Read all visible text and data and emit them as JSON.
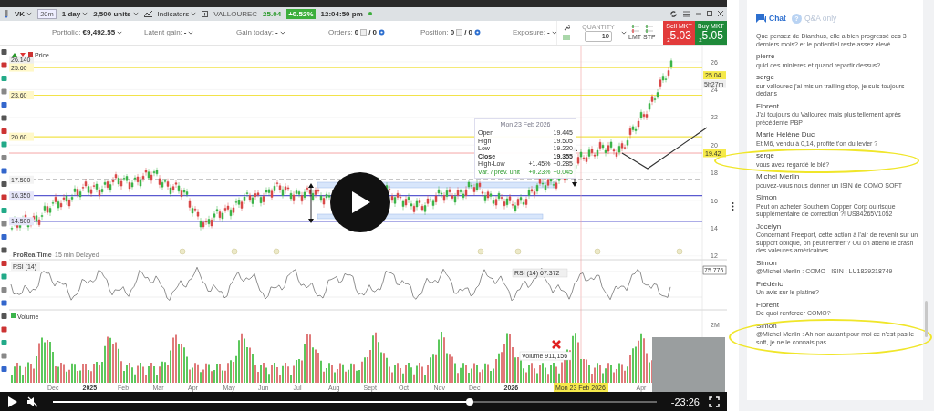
{
  "toolbar": {
    "symbol": "VK",
    "interval": "20m",
    "period": "1 day",
    "units": "2,500 units",
    "indicators": "Indicators",
    "instrument": "VALLOUREC",
    "last_price": "25.04",
    "change": "+0.52%",
    "time": "12:04:50 pm"
  },
  "account": [
    {
      "kind": "value",
      "label": "Portfolio:",
      "value": "€9,492.55"
    },
    {
      "kind": "value",
      "label": "Latent gain:",
      "value": "-"
    },
    {
      "kind": "value",
      "label": "Gain today:",
      "value": "-"
    },
    {
      "kind": "counter",
      "label": "Orders:",
      "value": "0",
      "total": "/ 0"
    },
    {
      "kind": "counter",
      "label": "Position:",
      "value": "0",
      "total": "/ 0"
    },
    {
      "kind": "value",
      "label": "Exposure:",
      "value": "-"
    }
  ],
  "order_ticket": {
    "quantity_label": "QUANTITY",
    "quantity": "10",
    "limit_label": "LMT",
    "stop_label": "STP",
    "sell": {
      "label": "Sell MKT",
      "price": "$_{2}$5.03"
    },
    "buy": {
      "label": "Buy MKT",
      "price": "$_{2}$5.05"
    }
  },
  "price_panel": {
    "legend": "Price",
    "source": "ProRealTime",
    "delay": "15 min Delayed",
    "axis_ticks": [
      "26",
      "24",
      "22",
      "20",
      "18",
      "16",
      "14",
      "12"
    ],
    "last_badge": "25.04",
    "countdown": "5h27m",
    "alert_badge": "19.42",
    "levels": [
      {
        "label": "26.140",
        "kind": "high"
      },
      {
        "label": "25.60",
        "kind": "resistance"
      },
      {
        "label": "23.60",
        "kind": "resistance"
      },
      {
        "label": "20.60",
        "kind": "resistance"
      },
      {
        "label": "17.500",
        "kind": "dashed"
      },
      {
        "label": "16.350",
        "kind": "support"
      },
      {
        "label": "14.500",
        "kind": "support"
      }
    ],
    "tooltip": {
      "date": "Mon 23 Feb 2026",
      "rows": [
        {
          "kind": "plain",
          "label": "Open",
          "value": "19.445"
        },
        {
          "kind": "plain",
          "label": "High",
          "value": "19.505"
        },
        {
          "kind": "plain",
          "label": "Low",
          "value": "19.220"
        },
        {
          "kind": "bold",
          "label": "Close",
          "value": "19.355"
        },
        {
          "kind": "plain",
          "label": "High-Low",
          "change": "+1.45%",
          "value": "+0.285"
        },
        {
          "kind": "positive",
          "label": "Var. / prev. unit",
          "change": "+0.23%",
          "value": "+0.045"
        }
      ]
    }
  },
  "rsi_panel": {
    "label": "RSI (14)",
    "reading": "RSI (14) 67.372",
    "last_badge": "75.776"
  },
  "volume_panel": {
    "label": "Volume",
    "axis_tick": "2M",
    "reading": "Volume 911,156"
  },
  "time_axis": [
    {
      "label": "Dec",
      "kind": "month"
    },
    {
      "label": "2025",
      "kind": "year"
    },
    {
      "label": "Feb",
      "kind": "month"
    },
    {
      "label": "Mar",
      "kind": "month"
    },
    {
      "label": "Apr",
      "kind": "month"
    },
    {
      "label": "May",
      "kind": "month"
    },
    {
      "label": "Jun",
      "kind": "month"
    },
    {
      "label": "Jul",
      "kind": "month"
    },
    {
      "label": "Aug",
      "kind": "month"
    },
    {
      "label": "Sept",
      "kind": "month"
    },
    {
      "label": "Oct",
      "kind": "month"
    },
    {
      "label": "Nov",
      "kind": "month"
    },
    {
      "label": "Dec",
      "kind": "month"
    },
    {
      "label": "2026",
      "kind": "year"
    },
    {
      "label": "Mon 23 Feb 2026",
      "kind": "cursor"
    },
    {
      "label": "Apr",
      "kind": "month"
    }
  ],
  "video": {
    "level": 0.69,
    "time": "-23:26"
  },
  "chat": {
    "tabs": [
      {
        "label": "Chat",
        "selected": true
      },
      {
        "label": "Q&A only",
        "icon": "?",
        "selected": false
      }
    ],
    "messages": [
      {
        "text": "Que pensez de Dianthus, elle a bien progressé ces 3 derniers mois? et le potientiel reste assez elevé...",
        "circled": false
      },
      {
        "author": "pierre",
        "text": "quid des minieres et quand repartir dessus?",
        "circled": false
      },
      {
        "author": "serge",
        "text": "sur vallourec j'ai mis un trailling stop, je suis toujours dedans",
        "circled": false
      },
      {
        "author": "Florent",
        "text": "J'ai toujours du Vallourec mais plus tellement après précédente PBP",
        "circled": false
      },
      {
        "author": "Marie Hélène Duc",
        "text": "Et M6, vendu à 0,14, profite t'on du levier ?",
        "circled": false
      },
      {
        "author": "serge",
        "text": "vous avez regardé le blé?",
        "circled": true
      },
      {
        "author": "Michel Merlin",
        "text": "pouvez-vous nous donner un ISIN de COMO SOFT",
        "circled": false
      },
      {
        "author": "Simon",
        "text": "Peut on acheter Southern Copper Corp ou risque supplémentaire de correction ?! US84265V1052",
        "circled": false
      },
      {
        "author": "Jocelyn",
        "text": "Concernant Freeport, cette action à l'air de revenir sur un support oblique, on peut rentrer ? Ou on attend le crash des valeures américaines.",
        "circled": false
      },
      {
        "author": "Simon",
        "text": "@Michel Merlin : COMO - ISIN : LU1829218749",
        "circled": false
      },
      {
        "author": "Frédéric",
        "text": "Un avis sur le platine?",
        "circled": false
      },
      {
        "author": "Florent",
        "text": "De quoi renforcer COMO?",
        "circled": false
      },
      {
        "author": "Simon",
        "text": "@Michel Merlin : Ah non autant pour moi ce n'est pas le soft, je ne le connais pas",
        "circled": true
      }
    ]
  }
}
